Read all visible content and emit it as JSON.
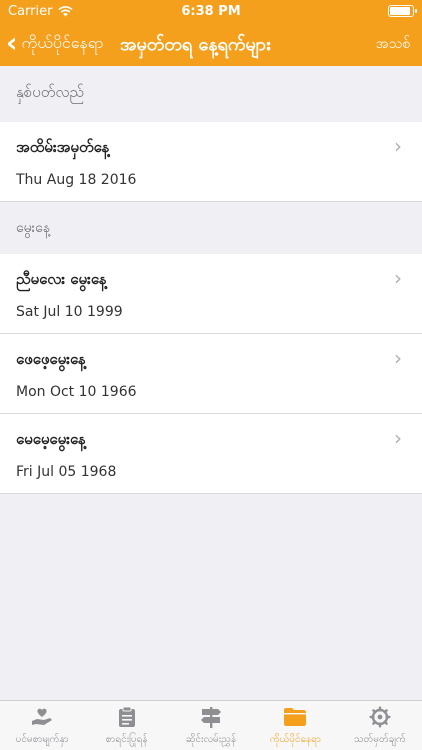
{
  "status": {
    "carrier": "Carrier",
    "time": "6:38 PM"
  },
  "nav": {
    "back_label": "ကိုယ်ပိုင်နေရာ",
    "title": "အမှတ်တရ နေ့ရက်များ",
    "new_label": "အသစ်"
  },
  "sections": [
    {
      "header": "နှစ်ပတ်လည်",
      "rows": [
        {
          "title": "အထိမ်းအမှတ်နေ့",
          "date": "Thu Aug 18 2016"
        }
      ]
    },
    {
      "header": "မွေးနေ့",
      "rows": [
        {
          "title": "ညီမလေး မွေးနေ့",
          "date": "Sat Jul 10 1999"
        },
        {
          "title": "ဖေဖေ့မွေးနေ့",
          "date": "Mon Oct 10 1966"
        },
        {
          "title": "မေမေ့မွေးနေ့",
          "date": "Fri Jul 05 1968"
        }
      ]
    }
  ],
  "tabs": [
    {
      "label": "ပင်မစာမျက်နှာ",
      "icon": "heart-hand-icon"
    },
    {
      "label": "စာရင်းပြုရန်",
      "icon": "clipboard-icon"
    },
    {
      "label": "ဆိုင်းလမ်းညွှန်",
      "icon": "signpost-icon"
    },
    {
      "label": "ကိုယ်ပိုင်နေရာ",
      "icon": "folder-icon",
      "active": true
    },
    {
      "label": "သတ်မှတ်ချက်",
      "icon": "gear-icon"
    }
  ],
  "colors": {
    "accent": "#f5a01d",
    "background": "#efeff4"
  }
}
